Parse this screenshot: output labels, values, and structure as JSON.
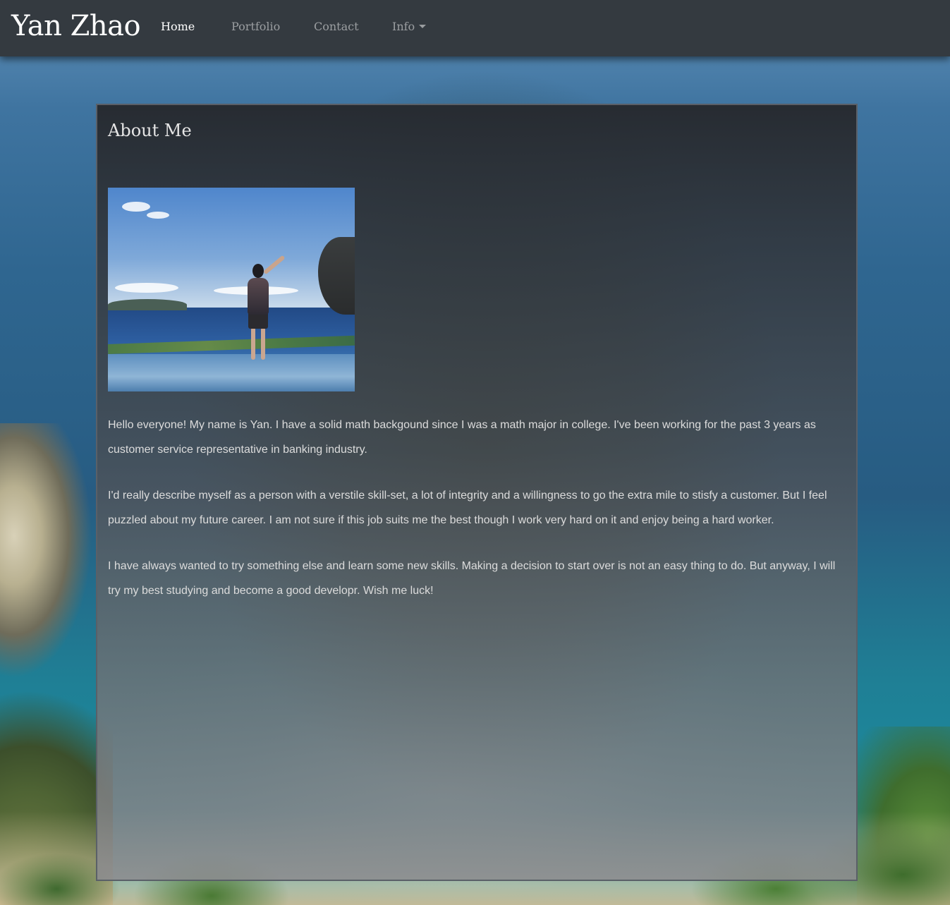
{
  "navbar": {
    "brand": "Yan Zhao",
    "links": [
      {
        "label": "Home",
        "active": true
      },
      {
        "label": "Portfolio",
        "active": false
      },
      {
        "label": "Contact",
        "active": false
      },
      {
        "label": "Info",
        "active": false,
        "dropdown": true
      }
    ]
  },
  "about": {
    "title": "About Me",
    "paragraphs": [
      "Hello everyone! My name is Yan. I have a solid math backgound since I was a math major in college. I've been working for the past 3 years as customer service representative in banking industry.",
      "I'd really describe myself as a person with a verstile skill-set, a lot of integrity and a willingness to go the extra mile to stisfy a customer. But I feel puzzled about my future career. I am not sure if this job suits me the best though I work very hard on it and enjoy being a hard worker.",
      "I have always wanted to try something else and learn some new skills. Making a decision to start over is not an easy thing to do. But anyway, I will try my best studying and become a good developr. Wish me luck!"
    ]
  },
  "colors": {
    "navbar_bg": "#343a40",
    "nav_active": "#ffffff",
    "nav_inactive": "rgba(255,255,255,0.5)",
    "card_text": "#dcdcdc"
  },
  "icons": {
    "info_dropdown": "caret-down-icon"
  }
}
